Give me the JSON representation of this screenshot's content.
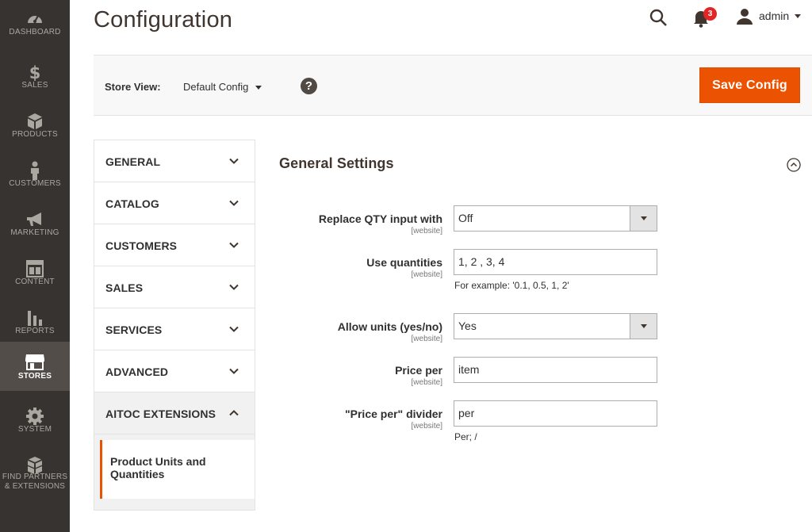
{
  "nav": {
    "items": [
      {
        "label": "DASHBOARD",
        "icon": "dashboard-icon"
      },
      {
        "label": "SALES",
        "icon": "dollar-icon"
      },
      {
        "label": "PRODUCTS",
        "icon": "cube-icon"
      },
      {
        "label": "CUSTOMERS",
        "icon": "person-icon"
      },
      {
        "label": "MARKETING",
        "icon": "megaphone-icon"
      },
      {
        "label": "CONTENT",
        "icon": "layout-icon"
      },
      {
        "label": "REPORTS",
        "icon": "bar-chart-icon"
      },
      {
        "label": "STORES",
        "icon": "store-icon"
      },
      {
        "label": "SYSTEM",
        "icon": "gear-icon"
      },
      {
        "label": "FIND PARTNERS & EXTENSIONS",
        "icon": "boxes-icon"
      }
    ],
    "active": "STORES"
  },
  "header": {
    "title": "Configuration",
    "notification_count": "3",
    "user_name": "admin"
  },
  "store_bar": {
    "label": "Store View:",
    "value": "Default Config",
    "help": "?",
    "save_label": "Save Config"
  },
  "tabs": {
    "items": [
      "GENERAL",
      "CATALOG",
      "CUSTOMERS",
      "SALES",
      "SERVICES",
      "ADVANCED",
      "AITOC EXTENSIONS"
    ],
    "open": "AITOC EXTENSIONS",
    "sub_item": "Product Units and Quantities"
  },
  "section": {
    "title": "General Settings",
    "fields": [
      {
        "label": "Replace QTY input with",
        "scope": "[website]",
        "type": "select",
        "value": "Off",
        "note": ""
      },
      {
        "label": "Use quantities",
        "scope": "[website]",
        "type": "text",
        "value": "1, 2 , 3, 4",
        "note": "For example: '0.1, 0.5, 1, 2'"
      },
      {
        "label": "Allow units (yes/no)",
        "scope": "[website]",
        "type": "select",
        "value": "Yes",
        "note": ""
      },
      {
        "label": "Price per",
        "scope": "[website]",
        "type": "text",
        "value": "item",
        "note": ""
      },
      {
        "label": "\"Price per\" divider",
        "scope": "[website]",
        "type": "text",
        "value": "per",
        "note": "Per; /"
      }
    ]
  },
  "colors": {
    "nav_bg": "#373330",
    "nav_active": "#524d49",
    "accent": "#eb5202",
    "badge": "#e22626"
  }
}
